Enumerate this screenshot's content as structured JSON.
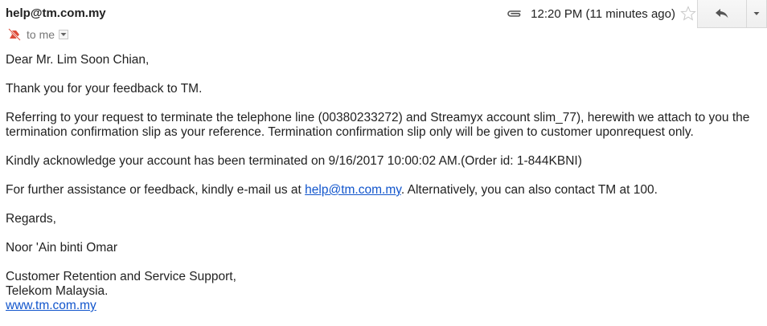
{
  "header": {
    "sender": "help@tm.com.my",
    "recipient_label": "to me",
    "time": "12:20 PM (11 minutes ago)",
    "icons": {
      "importance": "important-marker-icon",
      "attachment": "paperclip-icon",
      "star": "star-icon",
      "reply": "reply-arrow-icon",
      "more": "chevron-down-icon",
      "details": "chevron-down-icon"
    }
  },
  "message": {
    "greeting": "Dear Mr. Lim Soon Chian,",
    "thanks": "Thank you for your feedback to TM.",
    "paragraph_terminate": "Referring to your request to terminate the telephone line (00380233272) and Streamyx account slim_77), herewith we attach to you the termination confirmation slip as your reference. Termination confirmation slip only will be given to customer uponrequest only.",
    "acknowledge": "Kindly acknowledge your account has been terminated on 9/16/2017 10:00:02 AM.(Order id: 1-844KBNI)",
    "assist_before": "For further assistance or feedback, kindly e-mail us at ",
    "assist_link": "help@tm.com.my",
    "assist_after": ". Alternatively, you can also contact TM at 100.",
    "regards": "Regards,",
    "signer": "Noor 'Ain binti Omar",
    "department": "Customer Retention and Service Support,",
    "company": "Telekom Malaysia.",
    "website": "www.tm.com.my"
  },
  "colors": {
    "link": "#1155cc",
    "importance": "#dd4b39",
    "text": "#222222",
    "muted": "#777777"
  }
}
